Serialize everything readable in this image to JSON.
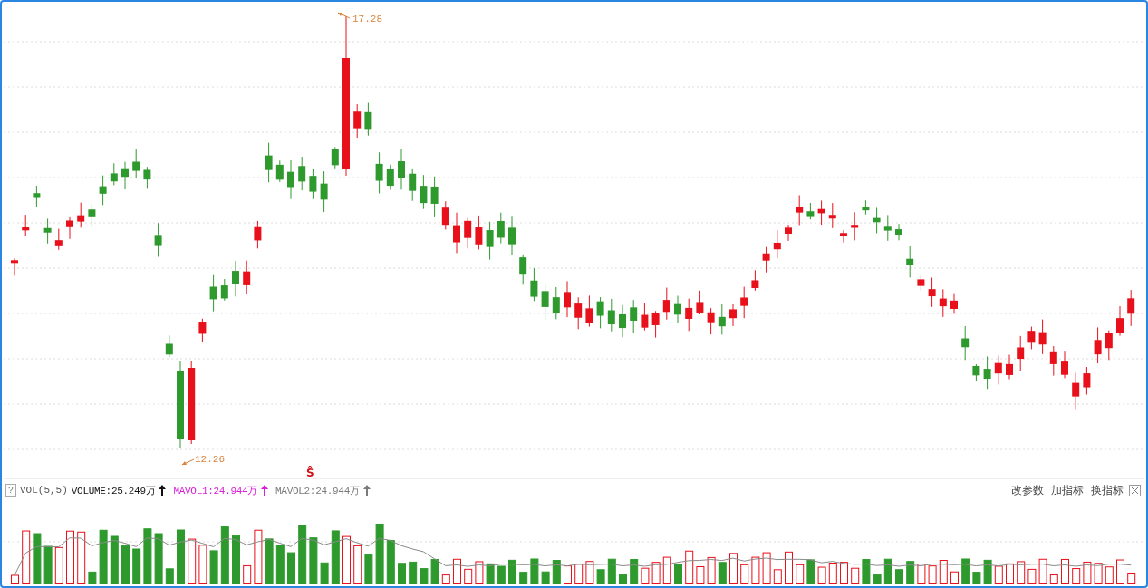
{
  "chart": {
    "high_label": "17.28",
    "low_label": "12.26",
    "marker": "Ŝ"
  },
  "indicator_bar": {
    "help": "?",
    "name": "VOL(5,5)",
    "series": [
      {
        "label": "VOLUME:25.249万",
        "color": "#111111"
      },
      {
        "label": "MAVOL1:24.944万",
        "color": "#d81ed8"
      },
      {
        "label": "MAVOL2:24.944万",
        "color": "#7a7a7a"
      }
    ],
    "actions": [
      "改参数",
      "加指标",
      "换指标"
    ]
  }
}
